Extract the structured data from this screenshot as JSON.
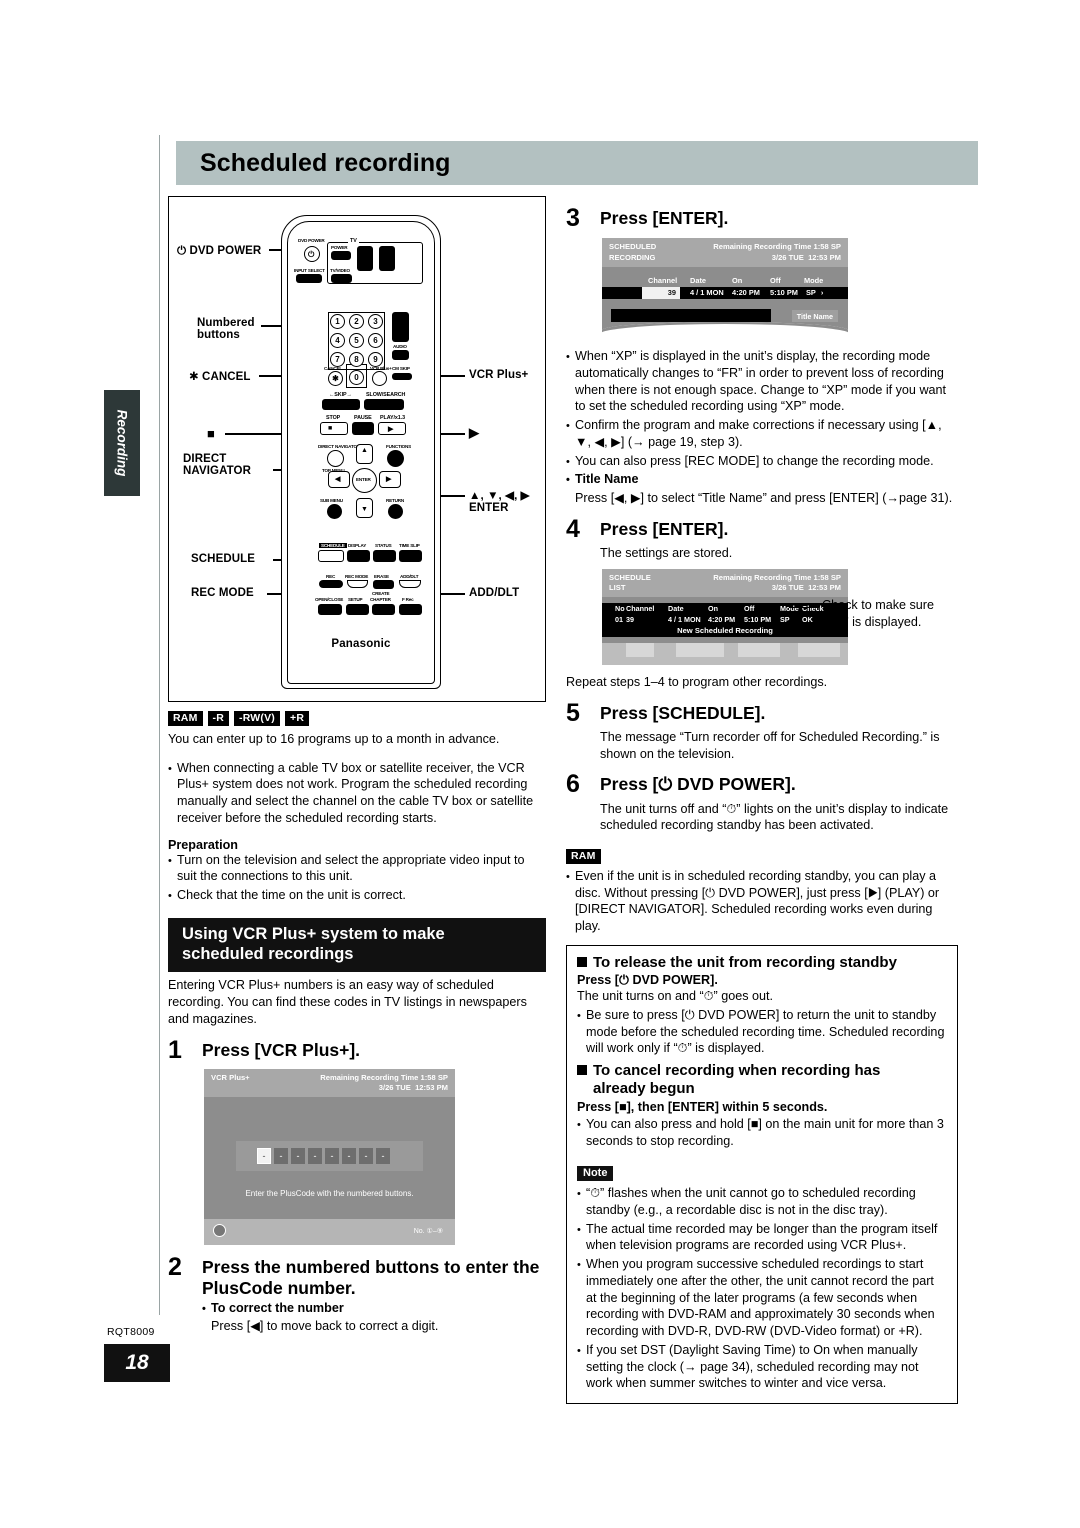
{
  "page": {
    "title": "Scheduled recording",
    "side_tab": "Recording",
    "footer_code": "RQT8009",
    "footer_page": "18"
  },
  "remote": {
    "brand": "Panasonic",
    "callouts": {
      "dvd_power": "DVD POWER",
      "numbered_buttons_l1": "Numbered",
      "numbered_buttons_l2": "buttons",
      "cancel": "CANCEL",
      "vcr_plus": "VCR Plus+",
      "stop": "■",
      "play": "▶",
      "direct_navigator_l1": "DIRECT",
      "direct_navigator_l2": "NAVIGATOR",
      "cursor_l1": "▲, ▼, ◀, ▶",
      "cursor_l2": "ENTER",
      "schedule": "SCHEDULE",
      "rec_mode": "REC MODE",
      "add_dlt": "ADD/DLT"
    },
    "keys": {
      "dvd_power": "DVD POWER",
      "tv": "TV",
      "tv_power": "POWER",
      "input_select": "INPUT SELECT",
      "tv_video": "TV/VIDEO",
      "audio": "AUDIO",
      "cancel": "CANCEL",
      "vcr_plus": "VCR Plus+",
      "cm_skip": "CM SKIP",
      "skip": "SKIP",
      "slow_search": "SLOW/SEARCH",
      "stop": "STOP",
      "pause": "PAUSE",
      "play": "PLAY/x1.3",
      "direct_navigator": "DIRECT NAVIGATOR",
      "top_menu": "TOP MENU",
      "functions": "FUNCTIONS",
      "sub_menu": "SUB MENU",
      "return": "RETURN",
      "enter": "ENTER",
      "schedule": "SCHEDULE",
      "display": "DISPLAY",
      "status": "STATUS",
      "time_slip": "TIME SLIP",
      "rec": "REC",
      "rec_mode": "REC MODE",
      "erase": "ERASE",
      "add_dlt": "ADD/DLT",
      "open_close": "OPEN/CLOSE",
      "setup": "SETUP",
      "create_chapter_l1": "CREATE",
      "create_chapter_l2": "CHAPTER",
      "f_rec": "F Rec",
      "numbers": [
        "1",
        "2",
        "3",
        "4",
        "5",
        "6",
        "7",
        "8",
        "9",
        "0"
      ],
      "star": "✱"
    }
  },
  "left": {
    "badges": [
      "RAM",
      "-R",
      "-RW(V)",
      "+R"
    ],
    "intro": "You can enter up to 16 programs up to a month in advance.",
    "bullets": [
      "When connecting a cable TV box or satellite receiver, the VCR Plus+ system does not work. Program the scheduled recording manually and select the channel on the cable TV box or satellite receiver before the scheduled recording starts."
    ],
    "preparation_heading": "Preparation",
    "preparation": [
      "Turn on the television and select the appropriate video input to suit the connections to this unit.",
      "Check that the time on the unit is correct."
    ],
    "section_heading_l1": "Using VCR Plus+ system to make",
    "section_heading_l2": "scheduled recordings",
    "section_intro": "Entering VCR Plus+ numbers is an easy way of scheduled recording. You can find these codes in TV listings in newspapers and magazines.",
    "step1": {
      "num": "1",
      "text": "Press [VCR Plus+]."
    },
    "step2": {
      "num": "2",
      "text": "Press the numbered buttons to enter the PlusCode number."
    },
    "step2_sub_heading": "To correct the number",
    "step2_sub_text": "Press [◀] to move back to correct a digit."
  },
  "osd_vcr": {
    "label": "VCR Plus+",
    "remaining_label": "Remaining Recording Time",
    "remaining_value": "1:58 SP",
    "date": "3/26 TUE",
    "time": "12:53 PM",
    "digits": [
      "-",
      "-",
      "-",
      "-",
      "-",
      "-",
      "-",
      "-"
    ],
    "message": "Enter the PlusCode with the numbered buttons.",
    "footer_no": "No.",
    "footer_range": "①–⑨"
  },
  "osd_scheduled": {
    "title_l1": "SCHEDULED",
    "title_l2": "RECORDING",
    "remaining_label": "Remaining Recording Time",
    "remaining_value": "1:58 SP",
    "date": "3/26 TUE",
    "time": "12:53 PM",
    "headers": [
      "Channel",
      "Date",
      "On",
      "Off",
      "Mode"
    ],
    "row": {
      "channel": "39",
      "date": "4 / 1 MON",
      "on": "4:20 PM",
      "off": "5:10 PM",
      "mode": "SP"
    },
    "title_name_button": "Title Name"
  },
  "osd_schedule_list": {
    "title_l1": "SCHEDULE",
    "title_l2": "LIST",
    "remaining_label": "Remaining Recording Time",
    "remaining_value": "1:58 SP",
    "date": "3/26 TUE",
    "time": "12:53 PM",
    "headers": [
      "No",
      "Channel",
      "Date",
      "On",
      "Off",
      "Mode",
      "Check"
    ],
    "row": {
      "no": "01",
      "channel": "39",
      "date": "4 / 1 MON",
      "on": "4:20 PM",
      "off": "5:10 PM",
      "mode": "SP",
      "check": "OK"
    },
    "new_entry": "New Scheduled Recording",
    "callout": "Check to make sure “OK” is displayed."
  },
  "right": {
    "step3": {
      "num": "3",
      "text": "Press [ENTER]."
    },
    "step3_bullets": [
      "When “XP” is displayed in the unit’s display, the recording mode automatically changes to “FR” in order to prevent loss of recording when there is not enough space. Change to “XP” mode if you want to set the scheduled recording using “XP” mode.",
      "Confirm the program and make corrections if necessary using [▲, ▼, ◀, ▶] (→ page 19, step 3).",
      "You can also press [REC MODE] to change the recording mode."
    ],
    "title_name_heading": "Title Name",
    "title_name_text": "Press [◀, ▶] to select “Title Name” and press [ENTER] (→page 31).",
    "step4": {
      "num": "4",
      "text": "Press [ENTER]."
    },
    "step4_sub": "The settings are stored.",
    "step4_repeat": "Repeat steps 1–4 to program other recordings.",
    "step5": {
      "num": "5",
      "text": "Press [SCHEDULE]."
    },
    "step5_sub": "The message “Turn recorder off for Scheduled Recording.” is shown on the television.",
    "step6": {
      "num": "6",
      "text": "Press [⏻ DVD POWER]."
    },
    "step6_sub": "The unit turns off and “⏱” lights on the unit’s display to indicate scheduled recording standby has been activated.",
    "ram_badge": "RAM",
    "ram_bullet": "Even if the unit is in scheduled recording standby, you can play a disc. Without pressing [⏻ DVD POWER], just press [▶] (PLAY) or [DIRECT NAVIGATOR]. Scheduled recording works even during play.",
    "release_heading": "To release the unit from recording standby",
    "release_press": "Press [⏻ DVD POWER].",
    "release_text": "The unit turns on and “⏱” goes out.",
    "release_bullet": "Be sure to press [⏻ DVD POWER] to return the unit to standby mode before the scheduled recording time. Scheduled recording will work only if “⏱” is displayed.",
    "cancel_heading_l1": "To cancel recording when recording has",
    "cancel_heading_l2": "already begun",
    "cancel_press": "Press [■], then [ENTER] within 5 seconds.",
    "cancel_bullet": "You can also press and hold [■] on the main unit for more than 3 seconds to stop recording.",
    "note_tag": "Note",
    "notes": [
      "“⏱” flashes when the unit cannot go to scheduled recording standby (e.g., a recordable disc is not in the disc tray).",
      "The actual time recorded may be longer than the program itself when television programs are recorded using VCR Plus+.",
      "When you program successive scheduled recordings to start immediately one after the other, the unit cannot record the part at the beginning of the later programs (a few seconds when recording with DVD-RAM and approximately 30 seconds when recording with DVD-R, DVD-RW (DVD-Video format) or +R).",
      "If you set DST (Daylight Saving Time) to On when manually setting the clock (→ page 34), scheduled recording may not work when summer switches to winter and vice versa."
    ]
  }
}
